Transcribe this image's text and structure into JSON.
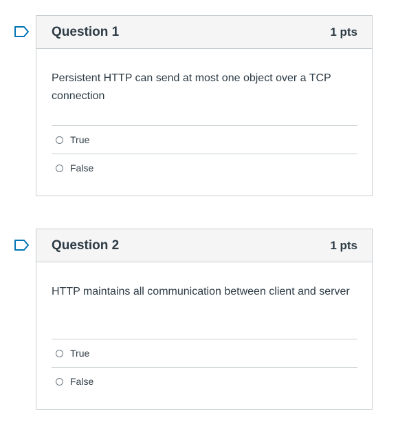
{
  "questions": [
    {
      "title": "Question 1",
      "points": "1 pts",
      "text": "Persistent HTTP can send at most one object over a TCP connection",
      "answers": [
        "True",
        "False"
      ]
    },
    {
      "title": "Question 2",
      "points": "1 pts",
      "text": "HTTP maintains all communication between client and server",
      "answers": [
        "True",
        "False"
      ]
    }
  ],
  "colors": {
    "flag": "#0374b5",
    "header_bg": "#f5f5f5",
    "border": "#c7cdd1",
    "text": "#2d3b45"
  },
  "icons": {
    "flag": "flag-question-icon",
    "radio": "radio-unchecked-icon"
  }
}
